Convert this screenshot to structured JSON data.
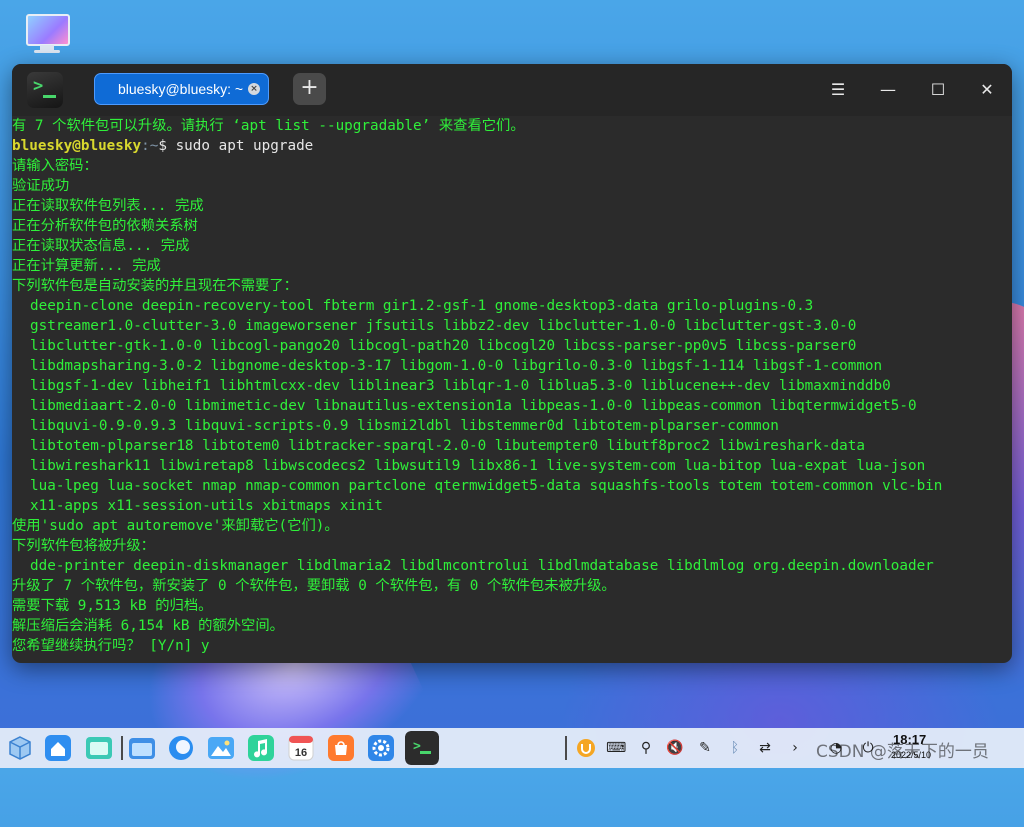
{
  "colors": {
    "terminal_bg": "#2b2b2b",
    "terminal_text_green": "#2ff03a",
    "prompt_user": "#d9d92e",
    "tab_active": "#0f6bd6",
    "taskbar_bg": "#e8f0fa"
  },
  "desktop": {
    "icon": "computer-icon"
  },
  "window": {
    "app_icon": "deepin-terminal-icon",
    "tab_title": "bluesky@bluesky: ~",
    "tab_close_glyph": "×",
    "new_tab_glyph": "+",
    "menu_glyph": "☰",
    "minimize_glyph": "—",
    "maximize_glyph": "☐",
    "close_glyph": "✕"
  },
  "terminal": {
    "line_upgradable": "有 7 个软件包可以升级。请执行 ‘apt list --upgradable’ 来查看它们。",
    "prompt": {
      "user": "bluesky@bluesky",
      "path": ":~",
      "symbol": "$ ",
      "command": "sudo apt upgrade"
    },
    "password": "请输入密码：",
    "auth_ok": "验证成功",
    "reading_lists": "正在读取软件包列表... 完成",
    "building_deps": "正在分析软件包的依赖关系树",
    "reading_state": "正在读取状态信息... 完成",
    "calc_upgrade": "正在计算更新... 完成",
    "auto_removable_header": "下列软件包是自动安装的并且现在不需要了：",
    "auto_removable": [
      "deepin-clone deepin-recovery-tool fbterm gir1.2-gsf-1 gnome-desktop3-data grilo-plugins-0.3",
      "gstreamer1.0-clutter-3.0 imageworsener jfsutils libbz2-dev libclutter-1.0-0 libclutter-gst-3.0-0",
      "libclutter-gtk-1.0-0 libcogl-pango20 libcogl-path20 libcogl20 libcss-parser-pp0v5 libcss-parser0",
      "libdmapsharing-3.0-2 libgnome-desktop-3-17 libgom-1.0-0 libgrilo-0.3-0 libgsf-1-114 libgsf-1-common",
      "libgsf-1-dev libheif1 libhtmlcxx-dev liblinear3 liblqr-1-0 liblua5.3-0 liblucene++-dev libmaxminddb0",
      "libmediaart-2.0-0 libmimetic-dev libnautilus-extension1a libpeas-1.0-0 libpeas-common libqtermwidget5-0",
      "libquvi-0.9-0.9.3 libquvi-scripts-0.9 libsmi2ldbl libstemmer0d libtotem-plparser-common",
      "libtotem-plparser18 libtotem0 libtracker-sparql-2.0-0 libutempter0 libutf8proc2 libwireshark-data",
      "libwireshark11 libwiretap8 libwscodecs2 libwsutil9 libx86-1 live-system-com lua-bitop lua-expat lua-json",
      "lua-lpeg lua-socket nmap nmap-common partclone qtermwidget5-data squashfs-tools totem totem-common vlc-bin",
      "x11-apps x11-session-utils xbitmaps xinit"
    ],
    "autoremove_hint": "使用'sudo apt autoremove'来卸载它(它们)。",
    "upgrade_header": "下列软件包将被升级：",
    "upgrade_list": "dde-printer deepin-diskmanager libdlmaria2 libdlmcontrolui libdlmdatabase libdlmlog org.deepin.downloader",
    "summary": "升级了 7 个软件包，新安装了 0 个软件包，要卸载 0 个软件包，有 0 个软件包未被升级。",
    "download_size": "需要下载 9,513 kB 的归档。",
    "disk_space": "解压缩后会消耗 6,154 kB 的额外空间。",
    "confirm": "您希望继续执行吗？ [Y/n] y"
  },
  "taskbar": {
    "apps": [
      "multitasking-icon",
      "launcher-icon",
      "desktop-icon",
      "file-manager-icon",
      "browser-icon",
      "image-viewer-icon",
      "music-icon",
      "calendar-icon",
      "app-store-icon",
      "settings-icon",
      "terminal-icon"
    ],
    "calendar_day": "16",
    "tray": [
      "update-icon",
      "keyboard-icon",
      "usb-icon",
      "volume-muted-icon",
      "pen-icon",
      "bluetooth-icon",
      "network-transfer-icon",
      "chevron-right-icon",
      "wifi-icon",
      "power-icon"
    ],
    "clock_time": "18:17",
    "clock_date": "2022/5/10"
  },
  "watermark": "CSDN @落天下的一员"
}
